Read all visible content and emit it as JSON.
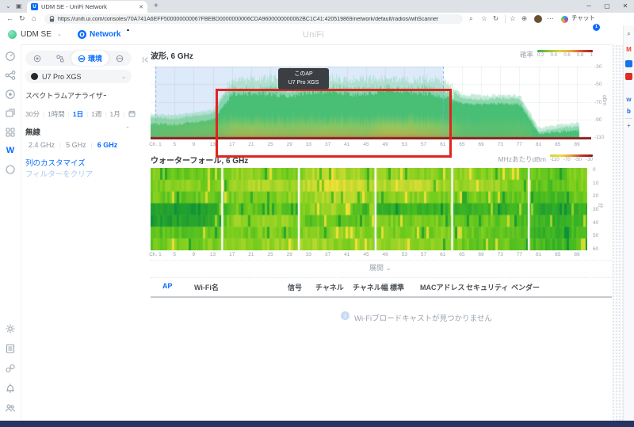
{
  "browser": {
    "tab_title": "UDM SE - UniFi Network",
    "favicon_letter": "U",
    "url": "https://unifi.ui.com/consoles/70A741A6EFF500000000067FBEBD0000000006CDA9600000000062BC1C41:420519869/network/default/radios/wifiScanner",
    "chat_button_label": "チャット"
  },
  "app_header": {
    "console_name": "UDM SE",
    "app_name": "Network",
    "watermark": "UniFi",
    "notification_badge": "1"
  },
  "left_rail": {
    "top_icons": [
      "gauge-icon",
      "topology-icon",
      "radio-icon",
      "devices-icon",
      "grid-icon",
      "wifiman-icon",
      "ring-icon"
    ],
    "bottom_icons": [
      "gear-icon",
      "journal-icon",
      "link-icon",
      "alarm-icon",
      "team-icon"
    ],
    "active_icon": "wifiman-icon"
  },
  "panel": {
    "tab_environment_label": "環境",
    "device_selector_value": "U7 Pro XGS",
    "spectrum_analyzer_label": "スペクトラムアナライザー",
    "spectrum_analyzer_on": true,
    "time_ranges": [
      "30分",
      "1時間",
      "1日",
      "1週",
      "1月"
    ],
    "selected_time_range": "1日",
    "wireless_label": "無線",
    "bands": [
      "2.4 GHz",
      "5 GHz",
      "6 GHz"
    ],
    "selected_band": "6 GHz",
    "customize_columns_label": "列のカスタマイズ",
    "clear_filters_label": "フィルターをクリア"
  },
  "chart_data": [
    {
      "type": "area",
      "id": "waveform",
      "title": "波形, 6 GHz",
      "ylabel": "dBm",
      "ylim": [
        -110,
        -30
      ],
      "yticks": [
        -30,
        -50,
        -70,
        -90,
        -110
      ],
      "x_first_label": "Ch. 1",
      "channels": [
        1,
        5,
        9,
        13,
        17,
        21,
        25,
        29,
        33,
        37,
        41,
        45,
        49,
        53,
        57,
        61,
        65,
        69,
        73,
        77,
        81,
        85,
        89
      ],
      "legend": {
        "label": "確率",
        "ticks": [
          "0.2",
          "0.4",
          "0.6",
          "0.8",
          "1"
        ]
      },
      "tooltip": {
        "line1": "このAP",
        "line2": "U7 Pro XGS"
      },
      "ap_channel_range": [
        1,
        61
      ],
      "highlight_channel_range": [
        15,
        62
      ],
      "baseline_dbm": -110,
      "series": {
        "peak_dbm": [
          -84,
          -85,
          -82,
          -79,
          -44,
          -45,
          -43,
          -46,
          -44,
          -42,
          -45,
          -44,
          -43,
          -45,
          -44,
          -46,
          -62,
          -63,
          -62,
          -63,
          -100,
          -96,
          -94
        ],
        "body_dbm": [
          -95,
          -96,
          -93,
          -90,
          -62,
          -60,
          -61,
          -63,
          -60,
          -58,
          -61,
          -62,
          -56,
          -58,
          -60,
          -64,
          -72,
          -73,
          -72,
          -73,
          -106,
          -104,
          -103
        ],
        "noise_intensity": [
          0.25,
          0.3,
          0.35,
          0.4,
          0.75,
          0.8,
          0.75,
          0.7,
          0.75,
          0.8,
          0.75,
          0.7,
          0.95,
          0.9,
          0.8,
          0.7,
          0.25,
          0.2,
          0.2,
          0.25,
          0.05,
          0.1,
          0.1
        ]
      }
    },
    {
      "type": "heatmap",
      "id": "waterfall",
      "title": "ウォーターフォール, 6 GHz",
      "legend": {
        "label": "MHzあたりdBm",
        "ticks": [
          "-110",
          "-70",
          "-50",
          "-30"
        ]
      },
      "ylabel": "分",
      "yticks": [
        0,
        10,
        20,
        30,
        40,
        50,
        60
      ],
      "x_first_label": "Ch. 1",
      "channels": [
        1,
        5,
        9,
        13,
        17,
        21,
        25,
        29,
        33,
        37,
        41,
        45,
        49,
        53,
        57,
        61,
        65,
        69,
        73,
        77,
        81,
        85,
        89
      ],
      "band_gap_channels": [
        15,
        31,
        47,
        63,
        79
      ],
      "grid": [
        [
          0.55,
          0.5,
          0.5,
          0.45,
          0.6,
          0.6,
          0.55,
          0.5,
          0.7,
          0.75,
          0.7,
          0.6,
          0.6,
          0.65,
          0.6,
          0.55,
          0.6,
          0.55,
          0.6,
          0.55,
          0.5,
          0.45,
          0.55
        ],
        [
          0.6,
          0.65,
          0.6,
          0.55,
          0.65,
          0.8,
          0.75,
          0.7,
          0.85,
          0.95,
          0.9,
          0.8,
          0.75,
          0.8,
          0.85,
          0.7,
          0.65,
          0.7,
          0.65,
          0.6,
          0.5,
          0.45,
          0.6
        ],
        [
          0.5,
          0.45,
          0.5,
          0.45,
          0.55,
          0.6,
          0.55,
          0.6,
          0.65,
          0.7,
          0.8,
          0.6,
          0.55,
          0.6,
          0.55,
          0.5,
          0.55,
          0.5,
          0.45,
          0.5,
          0.4,
          0.35,
          0.5
        ],
        [
          0.15,
          0.12,
          0.15,
          0.18,
          0.55,
          0.5,
          0.55,
          0.5,
          0.6,
          0.75,
          0.6,
          0.3,
          0.3,
          0.35,
          0.3,
          0.35,
          0.3,
          0.35,
          0.3,
          0.35,
          0.25,
          0.2,
          0.3
        ],
        [
          0.15,
          0.12,
          0.18,
          0.2,
          0.65,
          0.6,
          0.65,
          0.6,
          0.45,
          0.5,
          0.45,
          0.5,
          0.55,
          0.5,
          0.55,
          0.5,
          0.45,
          0.5,
          0.45,
          0.4,
          0.3,
          0.25,
          0.35
        ],
        [
          0.45,
          0.5,
          0.45,
          0.5,
          0.6,
          0.55,
          0.6,
          0.55,
          0.65,
          0.6,
          0.65,
          0.6,
          0.55,
          0.6,
          0.55,
          0.6,
          0.5,
          0.55,
          0.5,
          0.45,
          0.35,
          0.3,
          0.4
        ],
        [
          0.5,
          0.55,
          0.5,
          0.55,
          0.65,
          0.6,
          0.65,
          0.6,
          0.7,
          0.65,
          0.6,
          0.65,
          0.6,
          0.65,
          0.6,
          0.55,
          0.5,
          0.45,
          0.5,
          0.45,
          0.35,
          0.3,
          0.45
        ]
      ]
    }
  ],
  "table": {
    "expand_label": "展開",
    "columns": [
      "AP",
      "Wi-Fi名",
      "信号",
      "チャネル",
      "チャネル幅",
      "標準",
      "MACアドレス",
      "セキュリティ",
      "ベンダー"
    ],
    "rows": [],
    "empty_message": "Wi-Fiブロードキャストが見つかりません"
  }
}
